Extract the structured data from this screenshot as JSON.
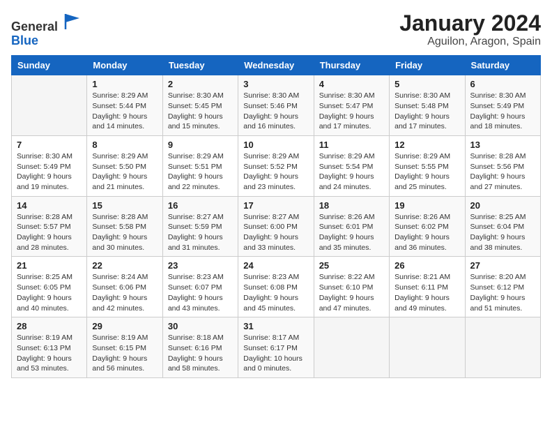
{
  "header": {
    "logo_general": "General",
    "logo_blue": "Blue",
    "month_title": "January 2024",
    "location": "Aguilon, Aragon, Spain"
  },
  "days_of_week": [
    "Sunday",
    "Monday",
    "Tuesday",
    "Wednesday",
    "Thursday",
    "Friday",
    "Saturday"
  ],
  "weeks": [
    [
      {
        "day": "",
        "sunrise": "",
        "sunset": "",
        "daylight": ""
      },
      {
        "day": "1",
        "sunrise": "Sunrise: 8:29 AM",
        "sunset": "Sunset: 5:44 PM",
        "daylight": "Daylight: 9 hours and 14 minutes."
      },
      {
        "day": "2",
        "sunrise": "Sunrise: 8:30 AM",
        "sunset": "Sunset: 5:45 PM",
        "daylight": "Daylight: 9 hours and 15 minutes."
      },
      {
        "day": "3",
        "sunrise": "Sunrise: 8:30 AM",
        "sunset": "Sunset: 5:46 PM",
        "daylight": "Daylight: 9 hours and 16 minutes."
      },
      {
        "day": "4",
        "sunrise": "Sunrise: 8:30 AM",
        "sunset": "Sunset: 5:47 PM",
        "daylight": "Daylight: 9 hours and 17 minutes."
      },
      {
        "day": "5",
        "sunrise": "Sunrise: 8:30 AM",
        "sunset": "Sunset: 5:48 PM",
        "daylight": "Daylight: 9 hours and 17 minutes."
      },
      {
        "day": "6",
        "sunrise": "Sunrise: 8:30 AM",
        "sunset": "Sunset: 5:49 PM",
        "daylight": "Daylight: 9 hours and 18 minutes."
      }
    ],
    [
      {
        "day": "7",
        "sunrise": "Sunrise: 8:30 AM",
        "sunset": "Sunset: 5:49 PM",
        "daylight": "Daylight: 9 hours and 19 minutes."
      },
      {
        "day": "8",
        "sunrise": "Sunrise: 8:29 AM",
        "sunset": "Sunset: 5:50 PM",
        "daylight": "Daylight: 9 hours and 21 minutes."
      },
      {
        "day": "9",
        "sunrise": "Sunrise: 8:29 AM",
        "sunset": "Sunset: 5:51 PM",
        "daylight": "Daylight: 9 hours and 22 minutes."
      },
      {
        "day": "10",
        "sunrise": "Sunrise: 8:29 AM",
        "sunset": "Sunset: 5:52 PM",
        "daylight": "Daylight: 9 hours and 23 minutes."
      },
      {
        "day": "11",
        "sunrise": "Sunrise: 8:29 AM",
        "sunset": "Sunset: 5:54 PM",
        "daylight": "Daylight: 9 hours and 24 minutes."
      },
      {
        "day": "12",
        "sunrise": "Sunrise: 8:29 AM",
        "sunset": "Sunset: 5:55 PM",
        "daylight": "Daylight: 9 hours and 25 minutes."
      },
      {
        "day": "13",
        "sunrise": "Sunrise: 8:28 AM",
        "sunset": "Sunset: 5:56 PM",
        "daylight": "Daylight: 9 hours and 27 minutes."
      }
    ],
    [
      {
        "day": "14",
        "sunrise": "Sunrise: 8:28 AM",
        "sunset": "Sunset: 5:57 PM",
        "daylight": "Daylight: 9 hours and 28 minutes."
      },
      {
        "day": "15",
        "sunrise": "Sunrise: 8:28 AM",
        "sunset": "Sunset: 5:58 PM",
        "daylight": "Daylight: 9 hours and 30 minutes."
      },
      {
        "day": "16",
        "sunrise": "Sunrise: 8:27 AM",
        "sunset": "Sunset: 5:59 PM",
        "daylight": "Daylight: 9 hours and 31 minutes."
      },
      {
        "day": "17",
        "sunrise": "Sunrise: 8:27 AM",
        "sunset": "Sunset: 6:00 PM",
        "daylight": "Daylight: 9 hours and 33 minutes."
      },
      {
        "day": "18",
        "sunrise": "Sunrise: 8:26 AM",
        "sunset": "Sunset: 6:01 PM",
        "daylight": "Daylight: 9 hours and 35 minutes."
      },
      {
        "day": "19",
        "sunrise": "Sunrise: 8:26 AM",
        "sunset": "Sunset: 6:02 PM",
        "daylight": "Daylight: 9 hours and 36 minutes."
      },
      {
        "day": "20",
        "sunrise": "Sunrise: 8:25 AM",
        "sunset": "Sunset: 6:04 PM",
        "daylight": "Daylight: 9 hours and 38 minutes."
      }
    ],
    [
      {
        "day": "21",
        "sunrise": "Sunrise: 8:25 AM",
        "sunset": "Sunset: 6:05 PM",
        "daylight": "Daylight: 9 hours and 40 minutes."
      },
      {
        "day": "22",
        "sunrise": "Sunrise: 8:24 AM",
        "sunset": "Sunset: 6:06 PM",
        "daylight": "Daylight: 9 hours and 42 minutes."
      },
      {
        "day": "23",
        "sunrise": "Sunrise: 8:23 AM",
        "sunset": "Sunset: 6:07 PM",
        "daylight": "Daylight: 9 hours and 43 minutes."
      },
      {
        "day": "24",
        "sunrise": "Sunrise: 8:23 AM",
        "sunset": "Sunset: 6:08 PM",
        "daylight": "Daylight: 9 hours and 45 minutes."
      },
      {
        "day": "25",
        "sunrise": "Sunrise: 8:22 AM",
        "sunset": "Sunset: 6:10 PM",
        "daylight": "Daylight: 9 hours and 47 minutes."
      },
      {
        "day": "26",
        "sunrise": "Sunrise: 8:21 AM",
        "sunset": "Sunset: 6:11 PM",
        "daylight": "Daylight: 9 hours and 49 minutes."
      },
      {
        "day": "27",
        "sunrise": "Sunrise: 8:20 AM",
        "sunset": "Sunset: 6:12 PM",
        "daylight": "Daylight: 9 hours and 51 minutes."
      }
    ],
    [
      {
        "day": "28",
        "sunrise": "Sunrise: 8:19 AM",
        "sunset": "Sunset: 6:13 PM",
        "daylight": "Daylight: 9 hours and 53 minutes."
      },
      {
        "day": "29",
        "sunrise": "Sunrise: 8:19 AM",
        "sunset": "Sunset: 6:15 PM",
        "daylight": "Daylight: 9 hours and 56 minutes."
      },
      {
        "day": "30",
        "sunrise": "Sunrise: 8:18 AM",
        "sunset": "Sunset: 6:16 PM",
        "daylight": "Daylight: 9 hours and 58 minutes."
      },
      {
        "day": "31",
        "sunrise": "Sunrise: 8:17 AM",
        "sunset": "Sunset: 6:17 PM",
        "daylight": "Daylight: 10 hours and 0 minutes."
      },
      {
        "day": "",
        "sunrise": "",
        "sunset": "",
        "daylight": ""
      },
      {
        "day": "",
        "sunrise": "",
        "sunset": "",
        "daylight": ""
      },
      {
        "day": "",
        "sunrise": "",
        "sunset": "",
        "daylight": ""
      }
    ]
  ]
}
